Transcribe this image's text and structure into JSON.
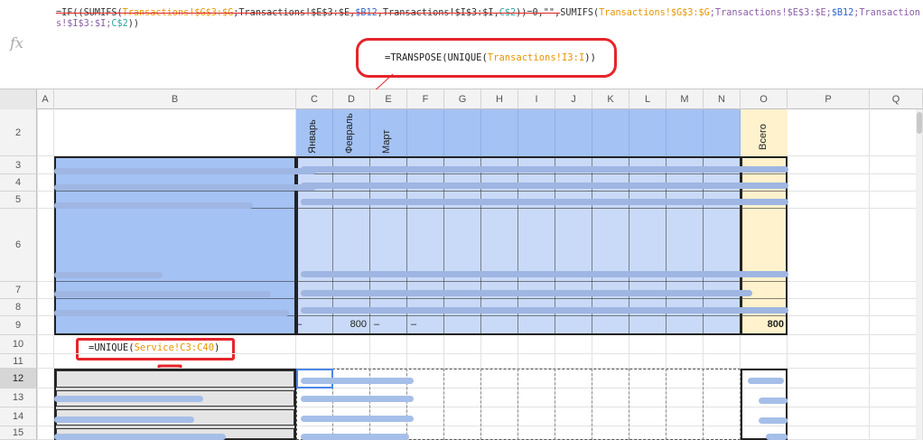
{
  "formula_bar": {
    "fx": "fx",
    "segments": [
      {
        "t": "=IF((SUMIFS(",
        "cls": "strike"
      },
      {
        "t": "Transactions!$G$3:$G",
        "cls": "strike c-orange"
      },
      {
        "t": ";Transactions!$E$3:$E,",
        "cls": "strike"
      },
      {
        "t": "$B12",
        "cls": "strike c-blue"
      },
      {
        "t": ",Transactions!$I$3:$I,",
        "cls": "strike"
      },
      {
        "t": "C$2",
        "cls": "strike c-teal"
      },
      {
        "t": "))=0,\"\",",
        "cls": "strike"
      },
      {
        "t": "SUMIFS(",
        "cls": ""
      },
      {
        "t": "Transactions!$G$3:$G",
        "cls": "c-orange"
      },
      {
        "t": ";Transactions!$E$3:$E;",
        "cls": "c-violet"
      },
      {
        "t": "$B12",
        "cls": "c-blue"
      },
      {
        "t": ";Transactions!$I$3:$I;",
        "cls": "c-violet"
      },
      {
        "t": "C$2",
        "cls": "c-teal"
      },
      {
        "t": "))",
        "cls": ""
      }
    ]
  },
  "callouts": {
    "transpose_prefix": "=TRANSPOSE(UNIQUE(",
    "transpose_ref": "Transactions!I3:I",
    "transpose_suffix": "))",
    "unique_prefix": "=UNIQUE(",
    "unique_ref": "Service!C3:C40",
    "unique_suffix": ")"
  },
  "columns": [
    "A",
    "B",
    "C",
    "D",
    "E",
    "F",
    "G",
    "H",
    "I",
    "J",
    "K",
    "L",
    "M",
    "N",
    "O",
    "P",
    "Q"
  ],
  "rows": [
    "2",
    "3",
    "4",
    "5",
    "6",
    "7",
    "8",
    "9",
    "10",
    "11",
    "12",
    "13",
    "14",
    "15"
  ],
  "months": [
    "Январь",
    "Февраль",
    "Март"
  ],
  "total_label": "Всего",
  "row9": {
    "c": "–",
    "d": "800",
    "e": "–",
    "f": "–",
    "o": "800"
  },
  "colors": {
    "header_blue": "#a4c2f4",
    "light_blue": "#c9daf8",
    "total_yellow": "#fff2cc",
    "callout_red": "#e5252a",
    "highlight_gray": "#d9d9d9"
  }
}
